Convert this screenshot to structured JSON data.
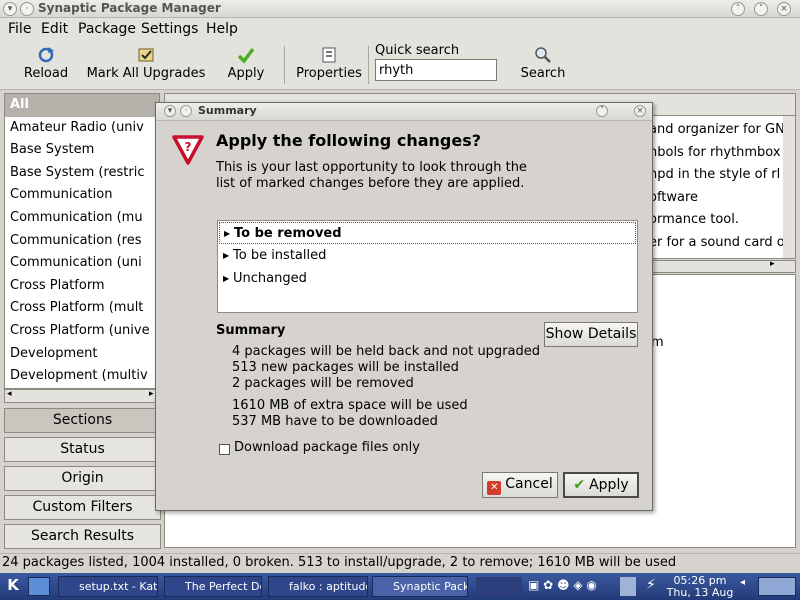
{
  "window": {
    "title": "Synaptic Package Manager"
  },
  "menu": [
    "File",
    "Edit",
    "Package",
    "Settings",
    "Help"
  ],
  "toolbar": {
    "reload": "Reload",
    "mark_all": "Mark All Upgrades",
    "apply": "Apply",
    "properties": "Properties",
    "quick_search_label": "Quick search",
    "quick_search_value": "rhyth",
    "search": "Search"
  },
  "sections": [
    "All",
    "Amateur Radio (univ",
    "Base System",
    "Base System (restric",
    "Communication",
    "Communication (mu",
    "Communication (res",
    "Communication (uni",
    "Cross Platform",
    "Cross Platform (mult",
    "Cross Platform (unive",
    "Development",
    "Development (multiv"
  ],
  "filters": {
    "sections": "Sections",
    "status": "Status",
    "origin": "Origin",
    "custom": "Custom Filters",
    "search_results": "Search Results"
  },
  "background_rows": [
    "and organizer for GN",
    "nbols for rhythmbox",
    "npd in the style of rl",
    "oftware",
    "ormance tool.",
    "er for a sound card o"
  ],
  "background_desc": "m",
  "statusbar": "24 packages listed, 1004 installed, 0 broken. 513 to install/upgrade, 2 to remove; 1610 MB will be used",
  "taskbar": {
    "tasks": [
      "setup.txt - Kate",
      "The Perfect Des",
      "falko : aptitude",
      "Synaptic Packa"
    ],
    "time": "05:26 pm",
    "date": "Thu, 13 Aug"
  },
  "dialog": {
    "title": "Summary",
    "heading": "Apply the following changes?",
    "intro": "This is your last opportunity to look through the list of marked changes before they are applied.",
    "changes": [
      "To be removed",
      "To be installed",
      "Unchanged"
    ],
    "summary_title": "Summary",
    "show_details": "Show Details",
    "summary_lines": [
      "4 packages will be held back and not upgraded",
      "513 new packages will be installed",
      "2 packages will be removed",
      "1610 MB of extra space will be used",
      "537 MB have to be downloaded"
    ],
    "download_only": "Download package files only",
    "cancel": "Cancel",
    "apply": "Apply"
  }
}
